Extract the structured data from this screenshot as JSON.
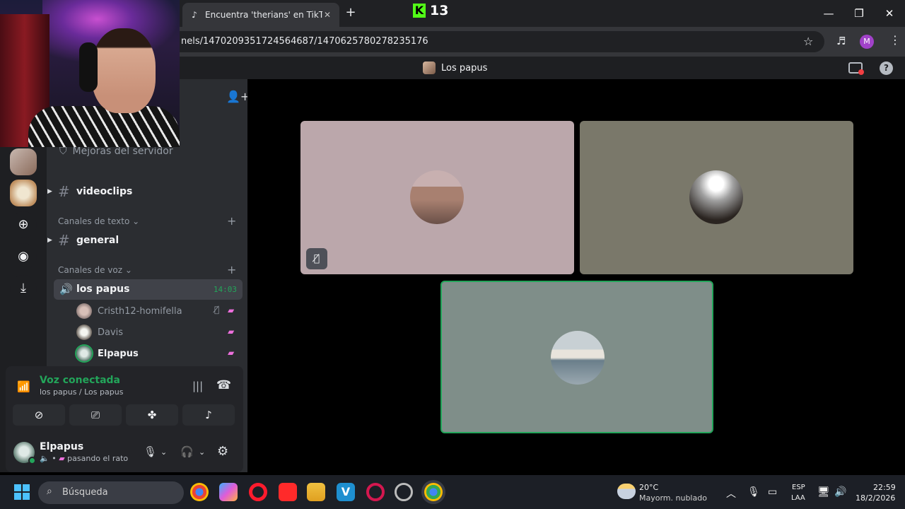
{
  "browser": {
    "tab_title": "Encuentra 'therians' en TikTok |",
    "tab_icon": "tiktok-icon",
    "new_tab": "+",
    "url": "nels/1470209351724564687/1470625780278235176",
    "profile_initial": "M",
    "window_buttons": [
      "—",
      "❐",
      "✕"
    ]
  },
  "overlay": {
    "kick_logo": "K",
    "kick_count": "13"
  },
  "discord": {
    "channel_title": "Los papus",
    "server_boost": "Mejoras del servidor",
    "channels": {
      "videoclips": "videoclips",
      "text_category": "Canales de texto",
      "general": "general",
      "voice_category": "Canales de voz",
      "voice_channel": "los papus",
      "voice_timer": "14:03"
    },
    "voice_members": [
      {
        "name": "Cristh12-homifella"
      },
      {
        "name": "Davis"
      },
      {
        "name": "Elpapus"
      }
    ],
    "voice_panel": {
      "status": "Voz conectada",
      "location": "los papus / Los papus"
    },
    "user": {
      "name": "Elpapus",
      "status": "pasando el rato"
    }
  },
  "taskbar": {
    "search_placeholder": "Búsqueda",
    "weather_temp": "20°C",
    "weather_desc": "Mayorm. nublado",
    "lang_top": "ESP",
    "lang_bottom": "LAA",
    "time": "22:59",
    "date": "18/2/2026"
  },
  "colors": {
    "discord_green": "#23a55a",
    "discord_sidebar": "#2b2d31",
    "tile_1": "#bba7ab",
    "tile_2": "#7a786a",
    "tile_3": "#7f8e89",
    "kick_green": "#53fc18"
  }
}
